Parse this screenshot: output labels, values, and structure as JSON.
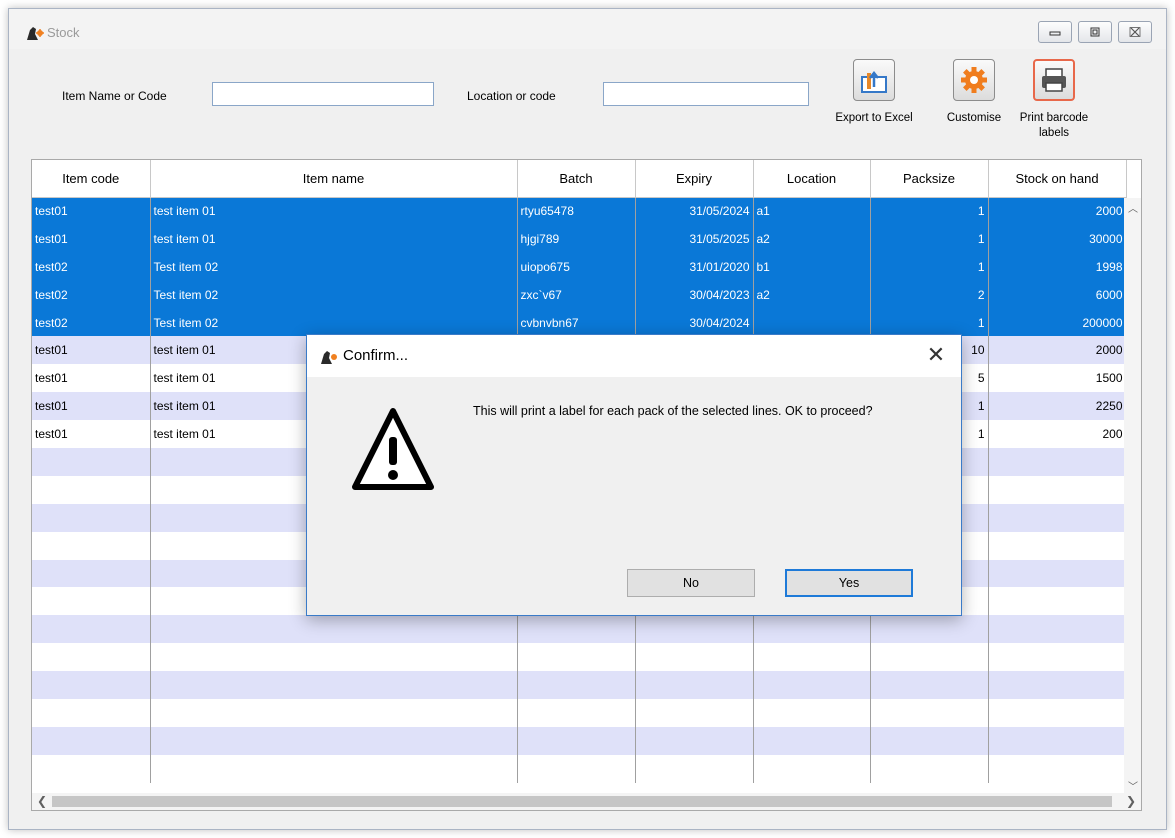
{
  "window": {
    "title": "Stock"
  },
  "filters": {
    "item_label": "Item Name or Code",
    "item_value": "",
    "location_label": "Location or code",
    "location_value": ""
  },
  "toolbar": {
    "export_label": "Export to Excel",
    "customise_label": "Customise",
    "print_label_1": "Print barcode",
    "print_label_2": "labels"
  },
  "table": {
    "columns": [
      "Item code",
      "Item name",
      "Batch",
      "Expiry",
      "Location",
      "Packsize",
      "Stock on hand"
    ],
    "rows": [
      {
        "code": "test01",
        "name": "test item 01",
        "batch": "rtyu65478",
        "expiry": "31/05/2024",
        "location": "a1",
        "packsize": "1",
        "soh": "2000",
        "selected": true
      },
      {
        "code": "test01",
        "name": "test item 01",
        "batch": "hjgi789",
        "expiry": "31/05/2025",
        "location": "a2",
        "packsize": "1",
        "soh": "30000",
        "selected": true
      },
      {
        "code": "test02",
        "name": "Test item 02",
        "batch": "uiopo675",
        "expiry": "31/01/2020",
        "location": "b1",
        "packsize": "1",
        "soh": "1998",
        "selected": true
      },
      {
        "code": "test02",
        "name": "Test item 02",
        "batch": "zxc`v67",
        "expiry": "30/04/2023",
        "location": "a2",
        "packsize": "2",
        "soh": "6000",
        "selected": true
      },
      {
        "code": "test02",
        "name": "Test item 02",
        "batch": "cvbnvbn67",
        "expiry": "30/04/2024",
        "location": "",
        "packsize": "1",
        "soh": "200000",
        "selected": true
      },
      {
        "code": "test01",
        "name": "test item 01",
        "batch": "",
        "expiry": "",
        "location": "",
        "packsize": "10",
        "soh": "2000",
        "selected": false
      },
      {
        "code": "test01",
        "name": "test item 01",
        "batch": "",
        "expiry": "",
        "location": "",
        "packsize": "5",
        "soh": "1500",
        "selected": false
      },
      {
        "code": "test01",
        "name": "test item 01",
        "batch": "",
        "expiry": "",
        "location": "",
        "packsize": "1",
        "soh": "2250",
        "selected": false
      },
      {
        "code": "test01",
        "name": "test item 01",
        "batch": "",
        "expiry": "",
        "location": "",
        "packsize": "1",
        "soh": "200",
        "selected": false
      }
    ]
  },
  "dialog": {
    "title": "Confirm...",
    "message": "This will print a label for each pack of the selected lines. OK to proceed?",
    "no_label": "No",
    "yes_label": "Yes"
  },
  "icons": {
    "app": "app-logo-icon",
    "export": "export-excel-icon",
    "customise": "gear-icon",
    "print": "printer-icon",
    "warning": "warning-triangle-icon"
  },
  "colors": {
    "selection": "#0a78d7",
    "row_alt": "#dfe1f9",
    "customise_icon": "#f07d1e",
    "print_icon": "#e8684a",
    "export_icon": "#3578c8"
  }
}
